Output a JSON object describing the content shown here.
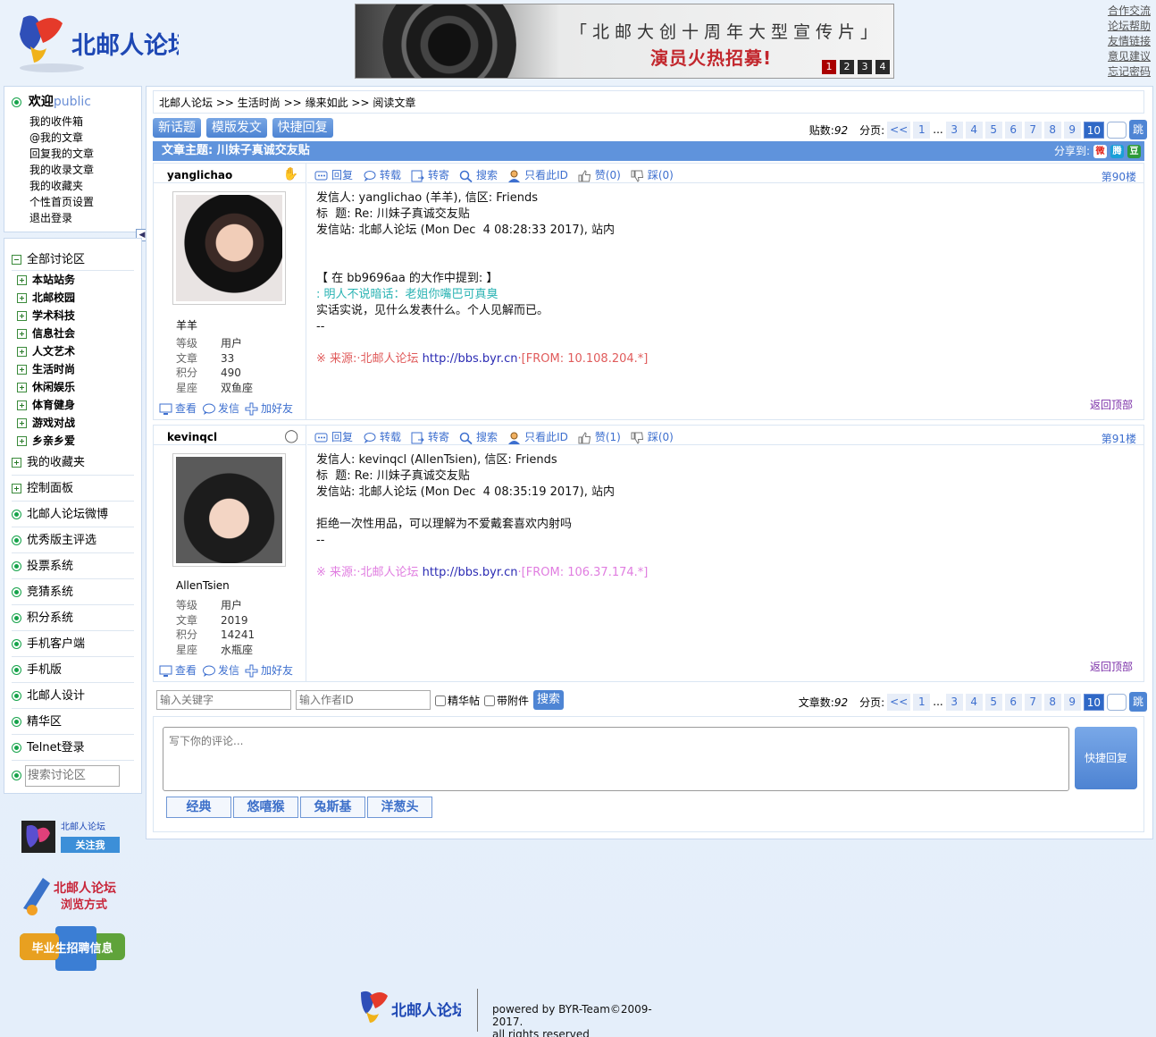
{
  "header": {
    "logo_text": "北邮人论坛",
    "banner": {
      "line1": "「北邮大创十周年大型宣传片」",
      "line2": "演员火热招募!",
      "slides": [
        "1",
        "2",
        "3",
        "4"
      ],
      "active_slide": "1"
    },
    "links": [
      "合作交流",
      "论坛帮助",
      "友情链接",
      "意见建议",
      "忘记密码"
    ]
  },
  "welcome": {
    "greeting": "欢迎",
    "username": "public",
    "menu": [
      "我的收件箱",
      "@我的文章",
      "回复我的文章",
      "我的收录文章",
      "我的收藏夹",
      "个性首页设置",
      "退出登录"
    ]
  },
  "nav": {
    "all_boards": "全部讨论区",
    "boards": [
      "本站站务",
      "北邮校园",
      "学术科技",
      "信息社会",
      "人文艺术",
      "生活时尚",
      "休闲娱乐",
      "体育健身",
      "游戏对战",
      "乡亲乡爱"
    ],
    "favorites": "我的收藏夹",
    "control_panel": "控制面板",
    "links": [
      "北邮人论坛微博",
      "优秀版主评选",
      "投票系统",
      "竞猜系统",
      "积分系统",
      "手机客户端",
      "手机版",
      "北邮人设计",
      "精华区",
      "Telnet登录"
    ],
    "search_placeholder": "搜索讨论区"
  },
  "promos": {
    "weibo_title": "北邮人论坛",
    "weibo_follow": "关注我",
    "browse_title": "北邮人论坛",
    "browse_sub": "浏览方式",
    "jobs": "毕业生招聘信息"
  },
  "breadcrumb": [
    "北邮人论坛",
    "生活时尚",
    "缘来如此",
    "阅读文章"
  ],
  "breadcrumb_sep": ">>",
  "toolbar": {
    "new_topic": "新话题",
    "template_post": "模版发文",
    "quick_reply": "快捷回复"
  },
  "pager_top": {
    "count_label": "贴数:",
    "count": "92",
    "page_label": "分页:",
    "prev": "<<",
    "pages": [
      "1",
      "...",
      "3",
      "4",
      "5",
      "6",
      "7",
      "8",
      "9",
      "10"
    ],
    "current": "10",
    "go": "跳"
  },
  "topic": {
    "title_label": "文章主题:",
    "title": "川妹子真诚交友贴",
    "share_label": "分享到:",
    "share_icons": [
      "weibo-icon",
      "tencent-weibo-icon",
      "douban-icon"
    ]
  },
  "post_actions": [
    "回复",
    "转载",
    "转寄",
    "搜索",
    "只看此ID"
  ],
  "user_actions": [
    "查看",
    "发信",
    "加好友"
  ],
  "back_to_top": "返回顶部",
  "posts": [
    {
      "user_id": "yanglichao",
      "nickname": "羊羊",
      "level_label": "等级",
      "level": "用户",
      "posts_label": "文章",
      "posts": "33",
      "score_label": "积分",
      "score": "490",
      "sign_label": "星座",
      "sign": "双鱼座",
      "like": "赞(0)",
      "dislike": "踩(0)",
      "floor": "第90楼",
      "line1": "发信人: yanglichao (羊羊), 信区: Friends",
      "line2": "标  题: Re: 川妹子真诚交友贴",
      "line3": "发信站: 北邮人论坛 (Mon Dec  4 08:28:33 2017), 站内",
      "quote_head": "【 在 bb9696aa 的大作中提到: 】",
      "quote": ": 明人不说暗话：老姐你嘴巴可真臭",
      "body": "实话实说，见什么发表什么。个人见解而已。",
      "sig": "--",
      "source": "※ 来源:·北邮人论坛 ",
      "source_link": "http://bbs.byr.cn",
      "source_from": "·[FROM: 10.108.204.*]"
    },
    {
      "user_id": "kevinqcl",
      "nickname": "AllenTsien",
      "level_label": "等级",
      "level": "用户",
      "posts_label": "文章",
      "posts": "2019",
      "score_label": "积分",
      "score": "14241",
      "sign_label": "星座",
      "sign": "水瓶座",
      "like": "赞(1)",
      "dislike": "踩(0)",
      "floor": "第91楼",
      "line1": "发信人: kevinqcl (AllenTsien), 信区: Friends",
      "line2": "标  题: Re: 川妹子真诚交友贴",
      "line3": "发信站: 北邮人论坛 (Mon Dec  4 08:35:19 2017), 站内",
      "body": "拒绝一次性用品，可以理解为不爱戴套喜欢内射吗",
      "sig": "--",
      "source": "※ 来源:·北邮人论坛 ",
      "source_link": "http://bbs.byr.cn",
      "source_from": "·[FROM: 106.37.174.*]"
    }
  ],
  "search": {
    "keyword_placeholder": "输入关键字",
    "author_placeholder": "输入作者ID",
    "digest": "精华帖",
    "attachment": "带附件",
    "button": "搜索"
  },
  "pager_bottom": {
    "count_label": "文章数:",
    "count": "92",
    "page_label": "分页:"
  },
  "reply": {
    "placeholder": "写下你的评论...",
    "button": "快捷回复",
    "emote_sets": [
      "经典",
      "悠嘻猴",
      "兔斯基",
      "洋葱头"
    ]
  },
  "footer": {
    "logo_text": "北邮人论坛",
    "line1": "powered by BYR-Team©2009-2017.",
    "line2": "all rights reserved"
  }
}
